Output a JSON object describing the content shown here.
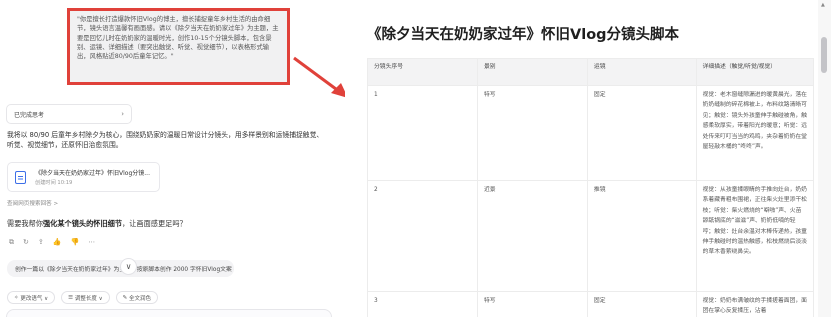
{
  "prompt_callout": "\"你是擅长打造爆款怀旧Vlog的博主，擅长捕捉童年乡村生活的由命细节，镜头语言温馨有画面感。请以《除夕当天在奶奶家过年》为主题，主要是回忆儿时在奶奶家的温暖时光，创作10-15个分镜头脚本，包含景别、运镜、详细描述（要突出触觉、听觉、视觉细节），以表格形式输出，风格贴近80/90后童年记忆。\"",
  "chat": {
    "thought_label": "已完成思考",
    "summary": "我将以 80/90 后童年乡村除夕为核心，围绕奶奶家的温暖日常设计分镜头，用多样景别和运镜捕捉触觉、听觉、视觉细节，还原怀旧治愈氛围。",
    "doc_card_title": "《除夕当天在奶奶家过年》怀旧Vlog分镜...",
    "doc_card_time": "创建时间 10:19",
    "refs_label": "查阅网页搜索回答 >",
    "question_prefix": "需要我帮你",
    "question_bold": "强化某个镜头的怀旧细节",
    "question_suffix": "，让画面感更足吗？",
    "action_icons": [
      "copy-icon",
      "refresh-icon",
      "share-icon",
      "thumbs-up-icon",
      "thumbs-down-icon",
      "more-icon"
    ],
    "action_glyphs": [
      "⧉",
      "↻",
      "⇪",
      "👍",
      "👎",
      "⋯"
    ],
    "suggestion": "创作一篇以《除夕当天在奶奶家过年》为主题，按原脚本创作 2000 字怀旧Vlog文案 →",
    "tools": [
      {
        "icon": "smile-icon",
        "glyph": "✧",
        "label": "更改语气 ∨"
      },
      {
        "icon": "length-icon",
        "glyph": "☰",
        "label": "调整长度 ∨"
      },
      {
        "icon": "sparkle-icon",
        "glyph": "✎",
        "label": "全文润色"
      }
    ]
  },
  "document": {
    "title": "《除夕当天在奶奶家过年》怀旧Vlog分镜头脚本",
    "columns": [
      "分镜头序号",
      "景别",
      "运镜",
      "详细描述（触觉/听觉/视觉）"
    ],
    "rows": [
      {
        "no": "1",
        "shot": "特写",
        "move": "固定",
        "desc": "视觉：老木窗缝隙漏进的暖黄晨光，落在奶奶缝制的碎花棉被上，布料纹路清晰可见；触觉：镜头外孩童伸手触碰被角，触感柔软厚实，带着阳光的暖意；听觉：远处传来叮叮当当的鸡鸣，夹杂着奶奶在堂屋轻敲木桶的“咚咚”声。"
      },
      {
        "no": "2",
        "shot": "近景",
        "move": "推镜",
        "desc": "视觉：从孩童揉眼睛的手推向灶台，奶奶系着藏青粗布围裙，正往柴火灶里添干松枝；听觉：柴火燃烧的“噼啪”声、火苗舔舐锅底的“滋滋”声、奶奶低喃的轻哼；触觉：灶台余温对木棒传递热，孩童伸手触碰时的温热触感，松枝燃烧后淡淡的草木香萦绕鼻尖。"
      },
      {
        "no": "3",
        "shot": "特写",
        "move": "固定",
        "desc": "视觉：奶奶布满皱纹的手揉搓着面团，面团在掌心反复揉压，沾着"
      }
    ]
  }
}
